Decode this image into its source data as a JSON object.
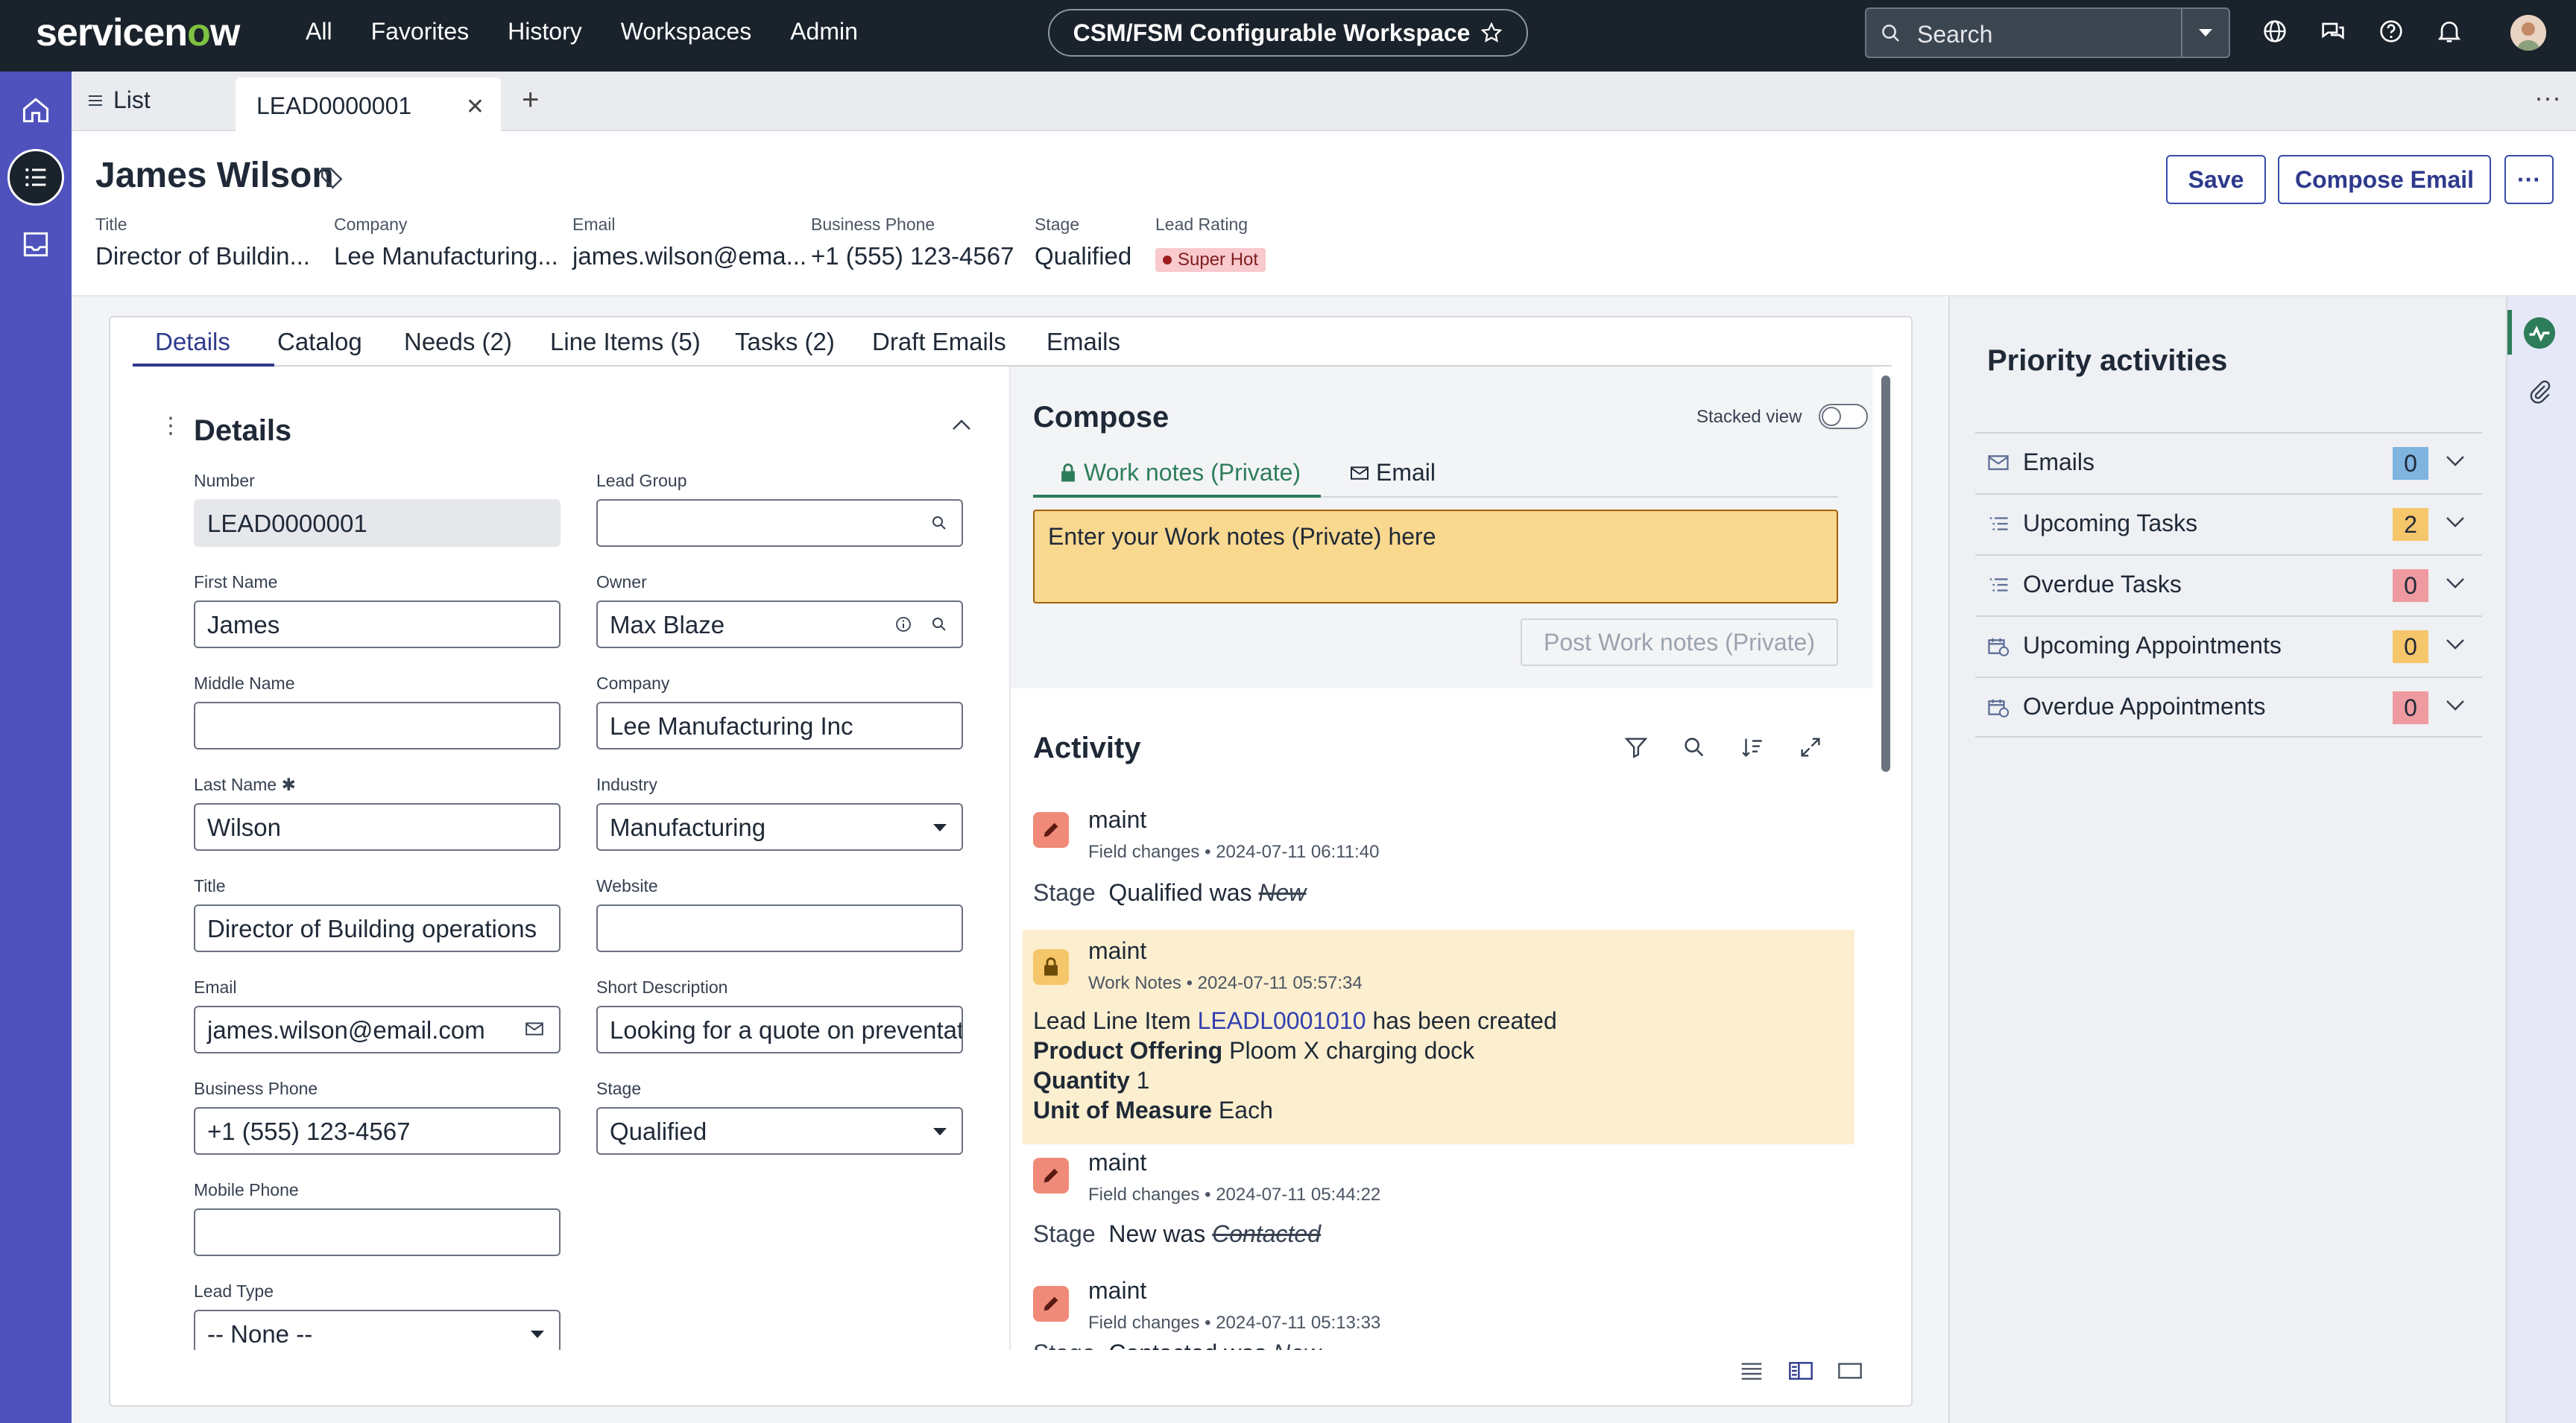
{
  "app": {
    "logo_text": "servicenow",
    "nav": [
      "All",
      "Favorites",
      "History",
      "Workspaces",
      "Admin"
    ],
    "workspace_title": "CSM/FSM Configurable Workspace",
    "search_placeholder": "Search"
  },
  "tabs": {
    "list_label": "List",
    "active_tab": "LEAD0000001"
  },
  "record": {
    "name": "James Wilson",
    "save_label": "Save",
    "compose_email_label": "Compose Email",
    "header_fields": [
      {
        "label": "Title",
        "value": "Director of Buildin..."
      },
      {
        "label": "Company",
        "value": "Lee Manufacturing..."
      },
      {
        "label": "Email",
        "value": "james.wilson@ema..."
      },
      {
        "label": "Business Phone",
        "value": "+1 (555) 123-4567"
      },
      {
        "label": "Stage",
        "value": "Qualified"
      },
      {
        "label": "Lead Rating",
        "value": "Super Hot"
      }
    ]
  },
  "detail_tabs": [
    "Details",
    "Catalog",
    "Needs (2)",
    "Line Items (5)",
    "Tasks (2)",
    "Draft Emails",
    "Emails"
  ],
  "details": {
    "section_title": "Details",
    "left": [
      {
        "label": "Number",
        "value": "LEAD0000001"
      },
      {
        "label": "First Name",
        "value": "James"
      },
      {
        "label": "Middle Name",
        "value": ""
      },
      {
        "label": "Last Name",
        "value": "Wilson"
      },
      {
        "label": "Title",
        "value": "Director of Building operations"
      },
      {
        "label": "Email",
        "value": "james.wilson@email.com"
      },
      {
        "label": "Business Phone",
        "value": "+1 (555) 123-4567"
      },
      {
        "label": "Mobile Phone",
        "value": ""
      },
      {
        "label": "Lead Type",
        "value": "-- None --"
      }
    ],
    "right": [
      {
        "label": "Lead Group",
        "value": ""
      },
      {
        "label": "Owner",
        "value": "Max Blaze"
      },
      {
        "label": "Company",
        "value": "Lee Manufacturing Inc"
      },
      {
        "label": "Industry",
        "value": "Manufacturing"
      },
      {
        "label": "Website",
        "value": ""
      },
      {
        "label": "Short Description",
        "value": "Looking for a quote on preventat"
      },
      {
        "label": "Stage",
        "value": "Qualified"
      }
    ]
  },
  "compose": {
    "title": "Compose",
    "stacked_view_label": "Stacked view",
    "tab_work_notes": "Work notes (Private)",
    "tab_email": "Email",
    "work_notes_placeholder": "Enter your Work notes (Private) here",
    "post_label": "Post Work notes (Private)"
  },
  "activity": {
    "title": "Activity",
    "entries": [
      {
        "user": "maint",
        "type": "Field changes",
        "time": "2024-07-11 06:11:40",
        "field": "Stage",
        "new": "Qualified",
        "was": "was",
        "old": "New"
      },
      {
        "user": "maint",
        "type": "Work Notes",
        "time": "2024-07-11 05:57:34",
        "line1_pre": "Lead Line Item",
        "line1_link": "LEADL0001010",
        "line1_post": "has been created",
        "l2_label": "Product Offering",
        "l2_value": "Ploom X charging dock",
        "l3_label": "Quantity",
        "l3_value": "1",
        "l4_label": "Unit of Measure",
        "l4_value": "Each"
      },
      {
        "user": "maint",
        "type": "Field changes",
        "time": "2024-07-11 05:44:22",
        "field": "Stage",
        "new": "New",
        "was": "was",
        "old": "Contacted"
      },
      {
        "user": "maint",
        "type": "Field changes",
        "time": "2024-07-11 05:13:33",
        "field": "Stage",
        "new": "Contacted",
        "was": "was",
        "old": "New"
      }
    ]
  },
  "priority": {
    "title": "Priority activities",
    "rows": [
      {
        "label": "Emails",
        "count": "0",
        "color": "#7fb3e0"
      },
      {
        "label": "Upcoming Tasks",
        "count": "2",
        "color": "#f6c66b"
      },
      {
        "label": "Overdue Tasks",
        "count": "0",
        "color": "#ef9aa0"
      },
      {
        "label": "Upcoming Appointments",
        "count": "0",
        "color": "#f6c66b"
      },
      {
        "label": "Overdue Appointments",
        "count": "0",
        "color": "#ef9aa0"
      }
    ]
  }
}
